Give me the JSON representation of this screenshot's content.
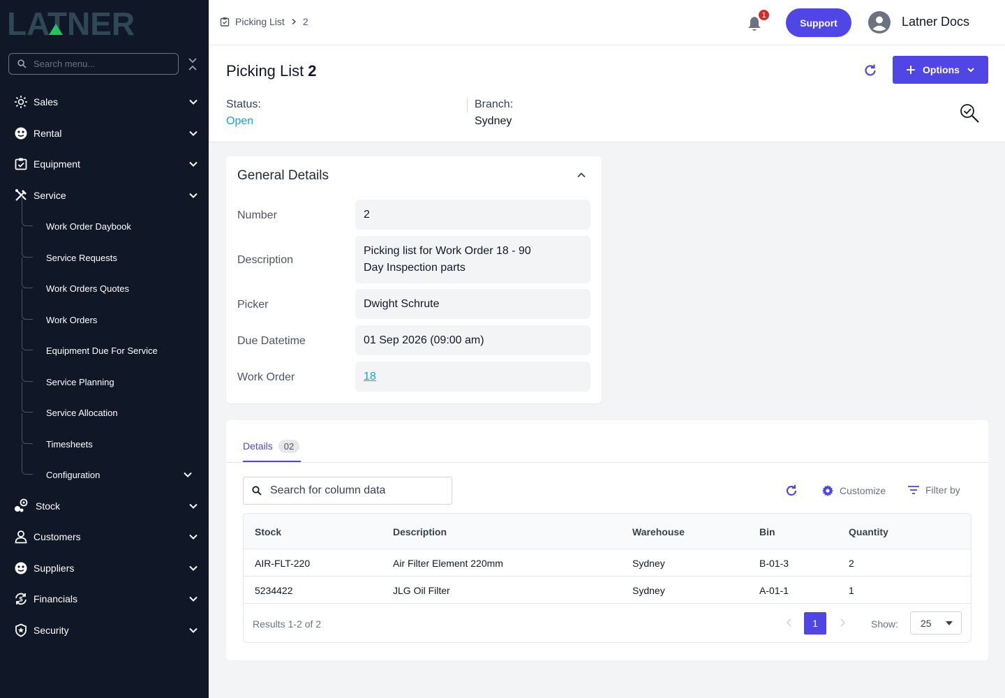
{
  "brand": {
    "logo_text": "LATNER",
    "accent": "#4f46e5",
    "sidebar_bg": "#101827"
  },
  "sidebar": {
    "search_placeholder": "Search menu...",
    "items": [
      {
        "label": "Sales",
        "icon": "sales-icon"
      },
      {
        "label": "Rental",
        "icon": "rental-icon"
      },
      {
        "label": "Equipment",
        "icon": "equipment-icon"
      },
      {
        "label": "Service",
        "icon": "service-icon"
      },
      {
        "label": "Stock",
        "icon": "stock-icon"
      },
      {
        "label": "Customers",
        "icon": "user-icon"
      },
      {
        "label": "Suppliers",
        "icon": "suppliers-icon"
      },
      {
        "label": "Financials",
        "icon": "financials-icon"
      },
      {
        "label": "Security",
        "icon": "shield-icon"
      }
    ],
    "service_children": [
      {
        "label": "Work Order Daybook"
      },
      {
        "label": "Service Requests"
      },
      {
        "label": "Work Orders Quotes"
      },
      {
        "label": "Work Orders"
      },
      {
        "label": "Equipment Due For Service"
      },
      {
        "label": "Service Planning"
      },
      {
        "label": "Service Allocation"
      },
      {
        "label": "Timesheets"
      },
      {
        "label": "Configuration"
      }
    ]
  },
  "topbar": {
    "breadcrumb": {
      "parent": "Picking List",
      "current": "2"
    },
    "notification_count": "1",
    "support_label": "Support",
    "user_name": "Latner Docs"
  },
  "header": {
    "title": "Picking List",
    "number": "2",
    "options_label": "Options",
    "status_label": "Status:",
    "status_value": "Open",
    "branch_label": "Branch:",
    "branch_value": "Sydney"
  },
  "general": {
    "title": "General Details",
    "fields": [
      {
        "label": "Number",
        "value": "2"
      },
      {
        "label": "Description",
        "value": "Picking list for Work Order 18 - 90 Day Inspection parts"
      },
      {
        "label": "Picker",
        "value": "Dwight Schrute"
      },
      {
        "label": "Due Datetime",
        "value": "01 Sep 2026 (09:00 am)"
      },
      {
        "label": "Work Order",
        "value": "18"
      }
    ]
  },
  "details": {
    "tab_label": "Details",
    "tab_count": "02",
    "search_placeholder": "Search for column data",
    "customize_label": "Customize",
    "filter_label": "Filter by",
    "columns": [
      "Stock",
      "Description",
      "Warehouse",
      "Bin",
      "Quantity"
    ],
    "rows": [
      [
        "AIR-FLT-220",
        "Air Filter Element 220mm",
        "Sydney",
        "B-01-3",
        "2"
      ],
      [
        "5234422",
        "JLG Oil Filter",
        "Sydney",
        "A-01-1",
        "1"
      ]
    ],
    "results_text": "Results 1-2 of 2",
    "current_page": "1",
    "show_label": "Show:",
    "page_size": "25"
  }
}
